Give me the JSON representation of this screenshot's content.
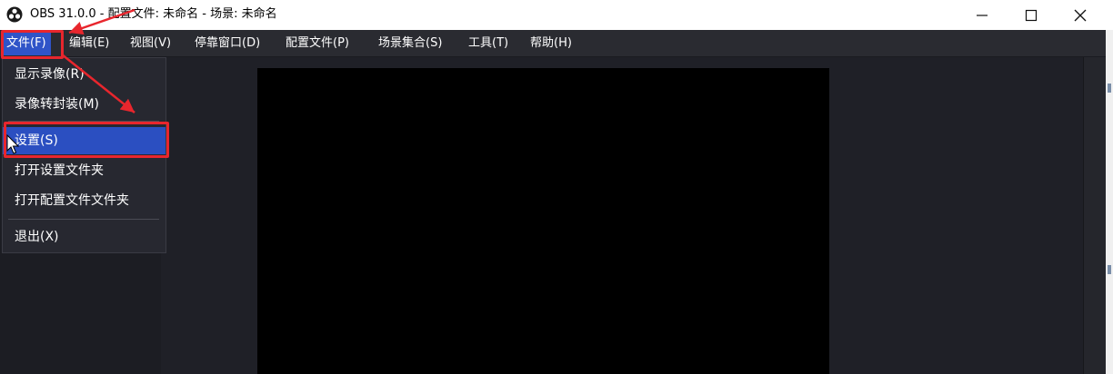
{
  "window": {
    "title": "OBS 31.0.0 - 配置文件: 未命名 - 场景: 未命名"
  },
  "menubar": {
    "items": [
      {
        "label": "文件(F)"
      },
      {
        "label": "编辑(E)"
      },
      {
        "label": "视图(V)"
      },
      {
        "label": "停靠窗口(D)"
      },
      {
        "label": "配置文件(P)"
      },
      {
        "label": "场景集合(S)"
      },
      {
        "label": "工具(T)"
      },
      {
        "label": "帮助(H)"
      }
    ]
  },
  "file_menu": {
    "items": [
      {
        "label": "显示录像(R)"
      },
      {
        "label": "录像转封装(M)"
      },
      {
        "label": "设置(S)",
        "highlighted": true
      },
      {
        "label": "打开设置文件夹"
      },
      {
        "label": "打开配置文件文件夹"
      },
      {
        "label": "退出(X)"
      }
    ]
  },
  "colors": {
    "accent": "#2b4fc1",
    "annotation": "#e8262d",
    "menubar_bg": "#2a2b31",
    "preview_bg": "#000000"
  },
  "icons": {
    "app": "obs-logo-icon",
    "minimize": "minimize-icon",
    "maximize": "maximize-icon",
    "close": "close-icon",
    "cursor": "mouse-pointer-icon"
  }
}
